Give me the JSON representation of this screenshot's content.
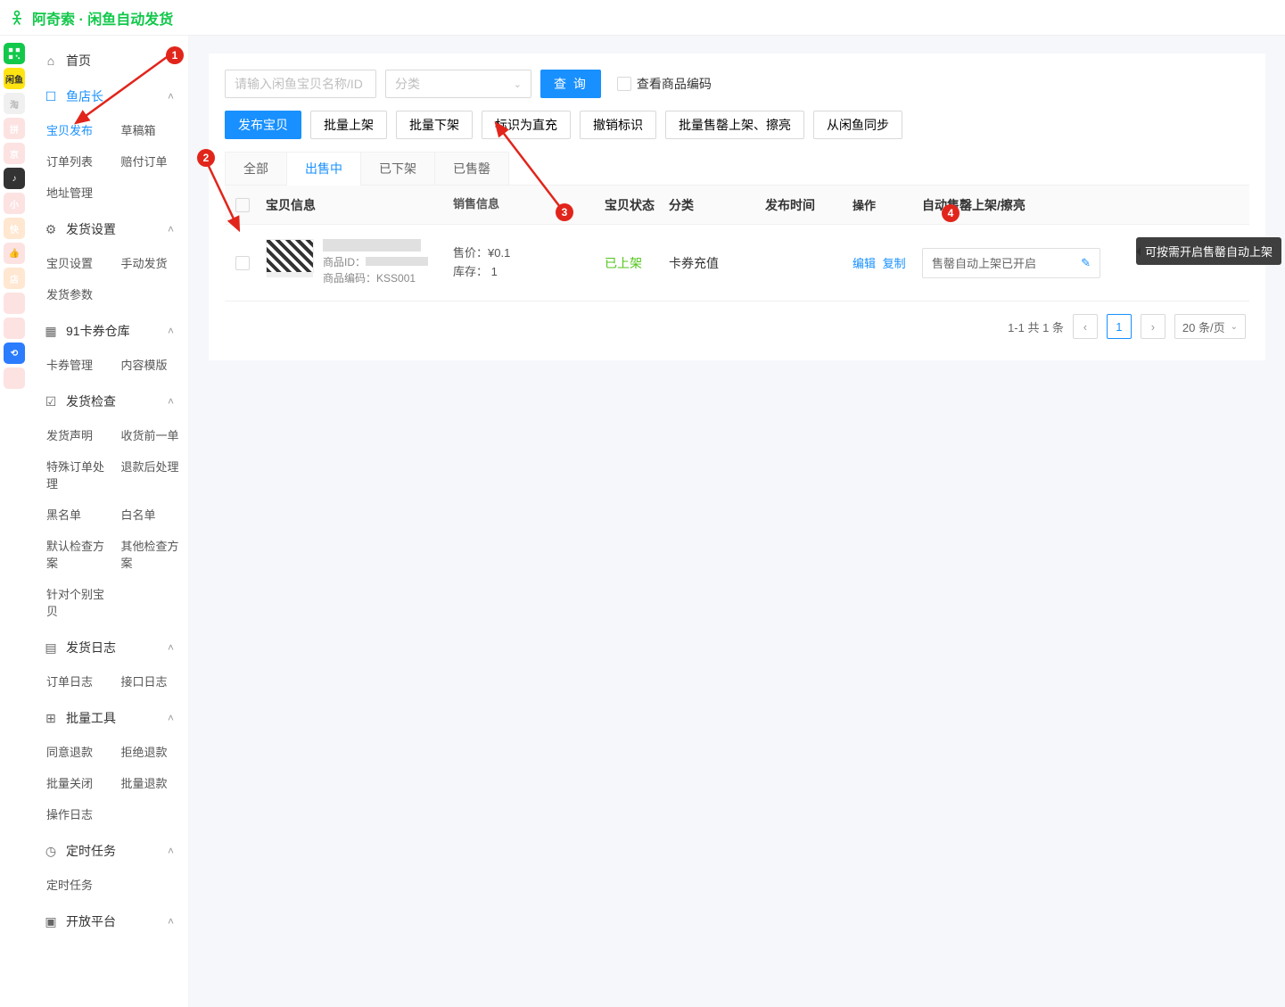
{
  "app": {
    "title": "阿奇索 · 闲鱼自动发货"
  },
  "sidebar": {
    "home": "首页",
    "sections": [
      {
        "label": "鱼店长",
        "active": true,
        "items": [
          "宝贝发布",
          "草稿箱",
          "订单列表",
          "赔付订单",
          "地址管理"
        ]
      },
      {
        "label": "发货设置",
        "items": [
          "宝贝设置",
          "手动发货",
          "发货参数"
        ]
      },
      {
        "label": "91卡券仓库",
        "items": [
          "卡券管理",
          "内容模版"
        ]
      },
      {
        "label": "发货检查",
        "items": [
          "发货声明",
          "收货前一单",
          "特殊订单处理",
          "退款后处理",
          "黑名单",
          "白名单",
          "默认检查方案",
          "其他检查方案",
          "针对个别宝贝"
        ]
      },
      {
        "label": "发货日志",
        "items": [
          "订单日志",
          "接口日志"
        ]
      },
      {
        "label": "批量工具",
        "items": [
          "同意退款",
          "拒绝退款",
          "批量关闭",
          "批量退款",
          "操作日志"
        ]
      },
      {
        "label": "定时任务",
        "items": [
          "定时任务"
        ]
      },
      {
        "label": "开放平台",
        "items": []
      }
    ]
  },
  "filter": {
    "search_placeholder": "请输入闲鱼宝贝名称/ID",
    "category_placeholder": "分类",
    "query_btn": "查 询",
    "view_code_label": "查看商品编码"
  },
  "actions": {
    "publish": "发布宝贝",
    "batch_on": "批量上架",
    "batch_off": "批量下架",
    "mark_direct": "标识为直充",
    "unmark": "撤销标识",
    "batch_soldout": "批量售罄上架、擦亮",
    "sync": "从闲鱼同步"
  },
  "tabs": [
    "全部",
    "出售中",
    "已下架",
    "已售罄"
  ],
  "active_tab": 1,
  "columns": {
    "info": "宝贝信息",
    "sale": "销售信息",
    "status": "宝贝状态",
    "category": "分类",
    "publish_time": "发布时间",
    "operate": "操作",
    "auto": "自动售罄上架/擦亮"
  },
  "row": {
    "product_id_label": "商品ID：",
    "product_code_label": "商品编码：",
    "product_code": "KSS001",
    "price_label": "售价：",
    "price": "¥0.1",
    "stock_label": "库存：",
    "stock": "1",
    "status": "已上架",
    "category": "卡券充值",
    "op_edit": "编辑",
    "op_copy": "复制",
    "auto_text": "售罄自动上架已开启"
  },
  "tooltip": "可按需开启售罄自动上架",
  "pager": {
    "total_text": "1-1 共 1 条",
    "current": "1",
    "size": "20 条/页"
  },
  "annotations": {
    "a1": "1",
    "a2": "2",
    "a3": "3",
    "a4": "4"
  }
}
